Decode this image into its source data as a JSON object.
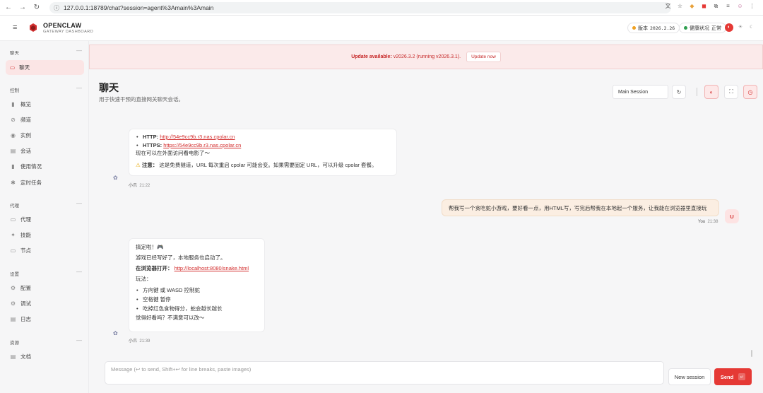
{
  "browser": {
    "url": "127.0.0.1:18789/chat?session=agent%3Amain%3Amain",
    "back_icon": "←",
    "forward_icon": "→",
    "reload_icon": "↻",
    "info_icon": "ⓘ",
    "right_icons": [
      "文",
      "☆",
      "◆",
      "◼",
      "⧉",
      "≡",
      "☺",
      "⋮"
    ]
  },
  "header": {
    "hamburger": "≡",
    "brand_title": "OPENCLAW",
    "brand_sub": "GATEWAY DASHBOARD",
    "version_label": "版本",
    "version_value": "2026.2.26",
    "health_label": "健康状况",
    "health_value": "正常",
    "icons": [
      "◐",
      "☀",
      "☾"
    ]
  },
  "sidebar": {
    "sections": [
      {
        "label": "聊天",
        "items": [
          {
            "icon": "▭",
            "label": "聊天"
          }
        ]
      },
      {
        "label": "控制",
        "items": [
          {
            "icon": "▮",
            "label": "概览"
          },
          {
            "icon": "⊘",
            "label": "频道"
          },
          {
            "icon": "◉",
            "label": "实例"
          },
          {
            "icon": "▤",
            "label": "会话"
          },
          {
            "icon": "▮",
            "label": "使用情况"
          },
          {
            "icon": "✱",
            "label": "定时任务"
          }
        ]
      },
      {
        "label": "代理",
        "items": [
          {
            "icon": "▭",
            "label": "代理"
          },
          {
            "icon": "✦",
            "label": "技能"
          },
          {
            "icon": "▭",
            "label": "节点"
          }
        ]
      },
      {
        "label": "设置",
        "items": [
          {
            "icon": "⚙",
            "label": "配置"
          },
          {
            "icon": "⚙",
            "label": "调试"
          },
          {
            "icon": "▤",
            "label": "日志"
          }
        ]
      },
      {
        "label": "资源",
        "items": [
          {
            "icon": "▤",
            "label": "文档"
          }
        ]
      }
    ],
    "toggle": "—"
  },
  "banner": {
    "bold": "Update available:",
    "rest": "v2026.3.2 (running v2026.3.1).",
    "button": "Update now"
  },
  "page": {
    "title": "聊天",
    "subtitle": "用于快速干预的直接网关聊天会话。",
    "session_select": "Main Session",
    "refresh_icon": "↻",
    "tool_icons": [
      "◐",
      "⛶",
      "◷"
    ]
  },
  "messages": {
    "m1": {
      "http_label": "HTTP:",
      "http_url": "http://54e9cc9b.r3.nas.cpolar.cn",
      "https_label": "HTTPS:",
      "https_url": "https://54e9cc9b.r3.nas.cpolar.cn",
      "line": "现在可以在外面访问看电影了～",
      "warn_icon": "⚠",
      "warn_bold": "注意：",
      "warn_text": "这是免费隧道，URL 每次重启 cpolar 可能会变。如果需要固定 URL，可以升级 cpolar 套餐。",
      "sender": "小爪",
      "time": "21:22"
    },
    "m2": {
      "text": "帮我写一个贪吃蛇小游戏，要好看一点，用HTML写，写完后帮我在本地起一个服务，让我能在浏览器里直接玩",
      "sender": "You",
      "time": "21:38",
      "avatar": "U"
    },
    "m3": {
      "line1": "搞定啦！🎮",
      "line2": "游戏已经写好了，本地服务也启动了。",
      "open_bold": "在浏览器打开：",
      "open_url": "http://localhost:8080/snake.html",
      "play_label": "玩法：",
      "items": [
        "方向键 或 WASD 控制蛇",
        "空格键 暂停",
        "吃掉红色食物得分，蛇会越长越长"
      ],
      "closing": "觉得好看吗？不满意可以改～",
      "sender": "小爪",
      "time": "21:39"
    },
    "bot_avatar": "✿"
  },
  "composer": {
    "placeholder": "Message (↩ to send, Shift+↩ for line breaks, paste images)",
    "new_session": "New session",
    "send": "Send",
    "send_key": "↵"
  }
}
